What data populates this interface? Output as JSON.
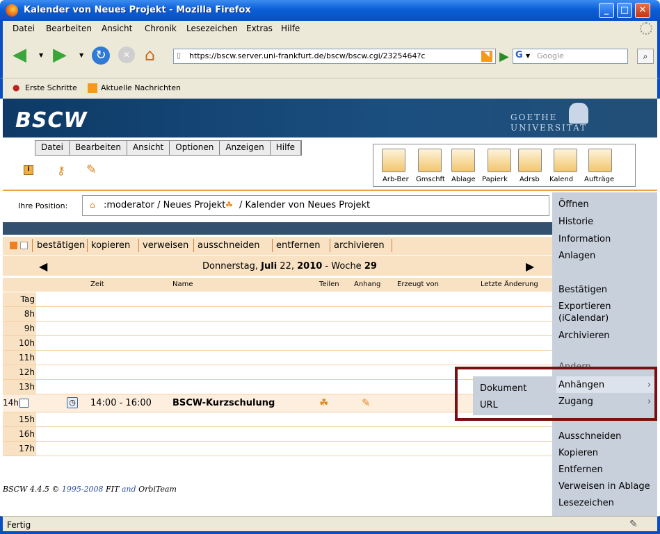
{
  "window": {
    "title": "Kalender von Neues Projekt - Mozilla Firefox"
  },
  "browser_menu": [
    "Datei",
    "Bearbeiten",
    "Ansicht",
    "Chronik",
    "Lesezeichen",
    "Extras",
    "Hilfe"
  ],
  "browser": {
    "url": "https://bscw.server.uni-frankfurt.de/bscw/bscw.cgi/2325464?c",
    "search_placeholder": "Google",
    "bookmarks": [
      "Erste Schritte",
      "Aktuelle Nachrichten"
    ],
    "status": "Fertig"
  },
  "bscw": {
    "logo": "BSCW",
    "university_line1": "GOETHE",
    "university_line2": "UNIVERSITÄT",
    "app_menu": [
      "Datei",
      "Bearbeiten",
      "Ansicht",
      "Optionen",
      "Anzeigen",
      "Hilfe"
    ],
    "nav_labels": [
      "Arb-Ber",
      "Gmschft",
      "Ablage",
      "Papierk",
      "Adrsb",
      "Kalend",
      "Aufträge"
    ],
    "position_label": "Ihre Position:",
    "breadcrumb_part1": ":moderator / Neues Projekt",
    "breadcrumb_part2": "/ Kalender von Neues Projekt",
    "actions": [
      "bestätigen",
      "kopieren",
      "verweisen",
      "ausschneiden",
      "entfernen",
      "archivieren"
    ],
    "date_prefix": "Donnerstag, ",
    "date_bold": "Juli",
    "date_mid": " 22, ",
    "date_year": "2010",
    "date_week_prefix": " - Woche ",
    "date_week": "29",
    "columns": [
      "Zeit",
      "Name",
      "Teilen",
      "Anhang",
      "Erzeugt von",
      "Letzte Änderung"
    ],
    "hours": [
      "Tag",
      "8h",
      "9h",
      "10h",
      "11h",
      "12h",
      "13h",
      "14h",
      "15h",
      "16h",
      "17h"
    ],
    "event": {
      "time": "14:00 - 16:00",
      "name": "BSCW-Kurzschulung"
    },
    "footer_version": "BSCW 4.4.5 ©",
    "footer_years": "1995-2008",
    "footer_fit": "FIT",
    "footer_and": "and",
    "footer_orbi": "OrbiTeam"
  },
  "context_menu": {
    "group1": [
      "Öffnen",
      "Historie",
      "Information",
      "Anlagen"
    ],
    "group2": [
      "Bestätigen",
      "Exportieren",
      "(iCalendar)",
      "Archivieren"
    ],
    "partial_item": "Ändern",
    "submenu_items": [
      "Anhängen",
      "Zugang"
    ],
    "group3": [
      "Ausschneiden",
      "Kopieren",
      "Entfernen",
      "Verweisen in Ablage",
      "Lesezeichen"
    ]
  },
  "submenu": [
    "Dokument",
    "URL"
  ],
  "colors": {
    "highlight": "#7a0f12",
    "calendar_bg": "#f9e2c3",
    "menu_bg": "#c8d0dc",
    "banner": "#1b4f80"
  }
}
